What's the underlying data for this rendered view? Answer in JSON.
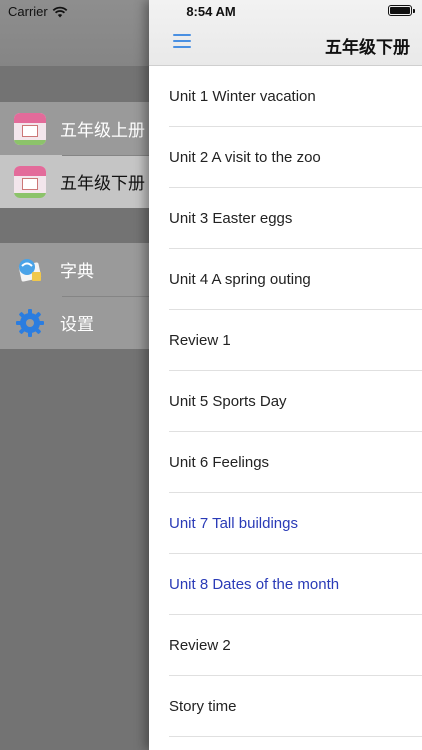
{
  "status_bar": {
    "carrier": "Carrier",
    "time": "8:54 AM"
  },
  "side_menu": {
    "books": [
      {
        "label": "五年级上册",
        "icon": "book-cover-icon",
        "selected": false
      },
      {
        "label": "五年级下册",
        "icon": "book-cover-icon",
        "selected": true
      }
    ],
    "tools": [
      {
        "label": "字典",
        "icon": "dictionary-icon"
      },
      {
        "label": "设置",
        "icon": "gear-icon"
      }
    ]
  },
  "header": {
    "title": "五年级下册",
    "menu_icon": "hamburger-menu-icon"
  },
  "lessons": [
    {
      "label": "Unit 1 Winter vacation"
    },
    {
      "label": "Unit 2 A visit to the zoo"
    },
    {
      "label": "Unit 3 Easter eggs"
    },
    {
      "label": "Unit 4 A spring outing"
    },
    {
      "label": "Review 1"
    },
    {
      "label": "Unit 5 Sports Day"
    },
    {
      "label": "Unit 6 Feelings"
    },
    {
      "label": "Unit 7 Tall buildings",
      "highlighted": true
    },
    {
      "label": "Unit 8 Dates of the month",
      "highlighted": true
    },
    {
      "label": "Review 2"
    },
    {
      "label": "Story time"
    }
  ],
  "colors": {
    "accent": "#4a90e2",
    "highlight_text": "#2a3bb7",
    "panel_bg": "#ffffff",
    "menu_bg": "#737373"
  }
}
